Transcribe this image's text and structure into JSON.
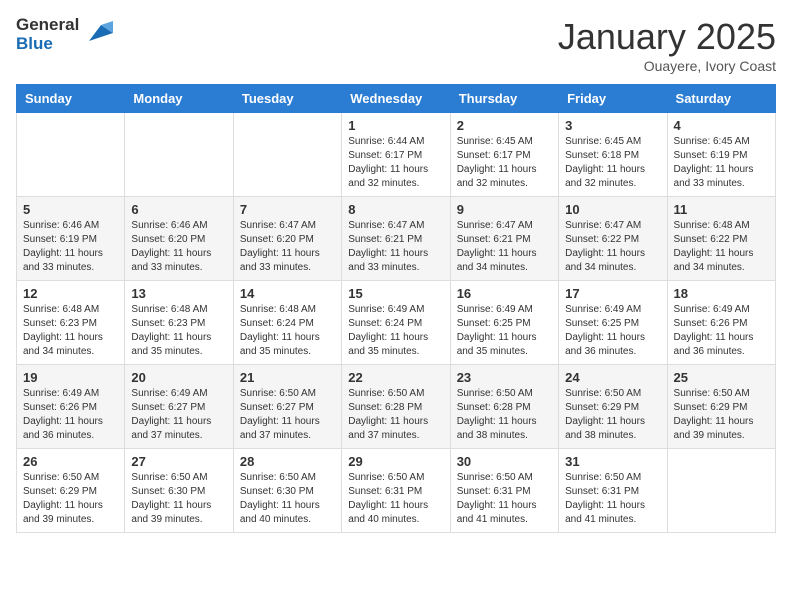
{
  "header": {
    "logo_general": "General",
    "logo_blue": "Blue",
    "month": "January 2025",
    "location": "Ouayere, Ivory Coast"
  },
  "days_of_week": [
    "Sunday",
    "Monday",
    "Tuesday",
    "Wednesday",
    "Thursday",
    "Friday",
    "Saturday"
  ],
  "weeks": [
    {
      "shaded": false,
      "days": [
        {
          "num": "",
          "sunrise": "",
          "sunset": "",
          "daylight": "",
          "empty": true
        },
        {
          "num": "",
          "sunrise": "",
          "sunset": "",
          "daylight": "",
          "empty": true
        },
        {
          "num": "",
          "sunrise": "",
          "sunset": "",
          "daylight": "",
          "empty": true
        },
        {
          "num": "1",
          "sunrise": "Sunrise: 6:44 AM",
          "sunset": "Sunset: 6:17 PM",
          "daylight": "Daylight: 11 hours and 32 minutes.",
          "empty": false
        },
        {
          "num": "2",
          "sunrise": "Sunrise: 6:45 AM",
          "sunset": "Sunset: 6:17 PM",
          "daylight": "Daylight: 11 hours and 32 minutes.",
          "empty": false
        },
        {
          "num": "3",
          "sunrise": "Sunrise: 6:45 AM",
          "sunset": "Sunset: 6:18 PM",
          "daylight": "Daylight: 11 hours and 32 minutes.",
          "empty": false
        },
        {
          "num": "4",
          "sunrise": "Sunrise: 6:45 AM",
          "sunset": "Sunset: 6:19 PM",
          "daylight": "Daylight: 11 hours and 33 minutes.",
          "empty": false
        }
      ]
    },
    {
      "shaded": true,
      "days": [
        {
          "num": "5",
          "sunrise": "Sunrise: 6:46 AM",
          "sunset": "Sunset: 6:19 PM",
          "daylight": "Daylight: 11 hours and 33 minutes.",
          "empty": false
        },
        {
          "num": "6",
          "sunrise": "Sunrise: 6:46 AM",
          "sunset": "Sunset: 6:20 PM",
          "daylight": "Daylight: 11 hours and 33 minutes.",
          "empty": false
        },
        {
          "num": "7",
          "sunrise": "Sunrise: 6:47 AM",
          "sunset": "Sunset: 6:20 PM",
          "daylight": "Daylight: 11 hours and 33 minutes.",
          "empty": false
        },
        {
          "num": "8",
          "sunrise": "Sunrise: 6:47 AM",
          "sunset": "Sunset: 6:21 PM",
          "daylight": "Daylight: 11 hours and 33 minutes.",
          "empty": false
        },
        {
          "num": "9",
          "sunrise": "Sunrise: 6:47 AM",
          "sunset": "Sunset: 6:21 PM",
          "daylight": "Daylight: 11 hours and 34 minutes.",
          "empty": false
        },
        {
          "num": "10",
          "sunrise": "Sunrise: 6:47 AM",
          "sunset": "Sunset: 6:22 PM",
          "daylight": "Daylight: 11 hours and 34 minutes.",
          "empty": false
        },
        {
          "num": "11",
          "sunrise": "Sunrise: 6:48 AM",
          "sunset": "Sunset: 6:22 PM",
          "daylight": "Daylight: 11 hours and 34 minutes.",
          "empty": false
        }
      ]
    },
    {
      "shaded": false,
      "days": [
        {
          "num": "12",
          "sunrise": "Sunrise: 6:48 AM",
          "sunset": "Sunset: 6:23 PM",
          "daylight": "Daylight: 11 hours and 34 minutes.",
          "empty": false
        },
        {
          "num": "13",
          "sunrise": "Sunrise: 6:48 AM",
          "sunset": "Sunset: 6:23 PM",
          "daylight": "Daylight: 11 hours and 35 minutes.",
          "empty": false
        },
        {
          "num": "14",
          "sunrise": "Sunrise: 6:48 AM",
          "sunset": "Sunset: 6:24 PM",
          "daylight": "Daylight: 11 hours and 35 minutes.",
          "empty": false
        },
        {
          "num": "15",
          "sunrise": "Sunrise: 6:49 AM",
          "sunset": "Sunset: 6:24 PM",
          "daylight": "Daylight: 11 hours and 35 minutes.",
          "empty": false
        },
        {
          "num": "16",
          "sunrise": "Sunrise: 6:49 AM",
          "sunset": "Sunset: 6:25 PM",
          "daylight": "Daylight: 11 hours and 35 minutes.",
          "empty": false
        },
        {
          "num": "17",
          "sunrise": "Sunrise: 6:49 AM",
          "sunset": "Sunset: 6:25 PM",
          "daylight": "Daylight: 11 hours and 36 minutes.",
          "empty": false
        },
        {
          "num": "18",
          "sunrise": "Sunrise: 6:49 AM",
          "sunset": "Sunset: 6:26 PM",
          "daylight": "Daylight: 11 hours and 36 minutes.",
          "empty": false
        }
      ]
    },
    {
      "shaded": true,
      "days": [
        {
          "num": "19",
          "sunrise": "Sunrise: 6:49 AM",
          "sunset": "Sunset: 6:26 PM",
          "daylight": "Daylight: 11 hours and 36 minutes.",
          "empty": false
        },
        {
          "num": "20",
          "sunrise": "Sunrise: 6:49 AM",
          "sunset": "Sunset: 6:27 PM",
          "daylight": "Daylight: 11 hours and 37 minutes.",
          "empty": false
        },
        {
          "num": "21",
          "sunrise": "Sunrise: 6:50 AM",
          "sunset": "Sunset: 6:27 PM",
          "daylight": "Daylight: 11 hours and 37 minutes.",
          "empty": false
        },
        {
          "num": "22",
          "sunrise": "Sunrise: 6:50 AM",
          "sunset": "Sunset: 6:28 PM",
          "daylight": "Daylight: 11 hours and 37 minutes.",
          "empty": false
        },
        {
          "num": "23",
          "sunrise": "Sunrise: 6:50 AM",
          "sunset": "Sunset: 6:28 PM",
          "daylight": "Daylight: 11 hours and 38 minutes.",
          "empty": false
        },
        {
          "num": "24",
          "sunrise": "Sunrise: 6:50 AM",
          "sunset": "Sunset: 6:29 PM",
          "daylight": "Daylight: 11 hours and 38 minutes.",
          "empty": false
        },
        {
          "num": "25",
          "sunrise": "Sunrise: 6:50 AM",
          "sunset": "Sunset: 6:29 PM",
          "daylight": "Daylight: 11 hours and 39 minutes.",
          "empty": false
        }
      ]
    },
    {
      "shaded": false,
      "days": [
        {
          "num": "26",
          "sunrise": "Sunrise: 6:50 AM",
          "sunset": "Sunset: 6:29 PM",
          "daylight": "Daylight: 11 hours and 39 minutes.",
          "empty": false
        },
        {
          "num": "27",
          "sunrise": "Sunrise: 6:50 AM",
          "sunset": "Sunset: 6:30 PM",
          "daylight": "Daylight: 11 hours and 39 minutes.",
          "empty": false
        },
        {
          "num": "28",
          "sunrise": "Sunrise: 6:50 AM",
          "sunset": "Sunset: 6:30 PM",
          "daylight": "Daylight: 11 hours and 40 minutes.",
          "empty": false
        },
        {
          "num": "29",
          "sunrise": "Sunrise: 6:50 AM",
          "sunset": "Sunset: 6:31 PM",
          "daylight": "Daylight: 11 hours and 40 minutes.",
          "empty": false
        },
        {
          "num": "30",
          "sunrise": "Sunrise: 6:50 AM",
          "sunset": "Sunset: 6:31 PM",
          "daylight": "Daylight: 11 hours and 41 minutes.",
          "empty": false
        },
        {
          "num": "31",
          "sunrise": "Sunrise: 6:50 AM",
          "sunset": "Sunset: 6:31 PM",
          "daylight": "Daylight: 11 hours and 41 minutes.",
          "empty": false
        },
        {
          "num": "",
          "sunrise": "",
          "sunset": "",
          "daylight": "",
          "empty": true
        }
      ]
    }
  ]
}
